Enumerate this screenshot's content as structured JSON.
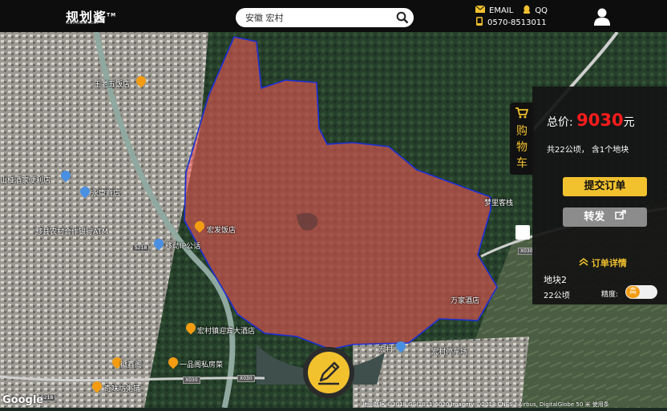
{
  "header": {
    "logo_text": "规划酱",
    "logo_tm": "TM",
    "logo_sub": "GuihuaO.com",
    "search_value": "安徽 宏村",
    "email_label": "EMAIL",
    "qq_label": "QQ",
    "phone": "0570-8513011"
  },
  "map": {
    "pois": [
      {
        "name": "王老五饭店"
      },
      {
        "name": "山桠酒家便利店"
      },
      {
        "name": "永康商店"
      },
      {
        "name": "黟县农村合作银行ATM"
      },
      {
        "name": "移动IP公话"
      },
      {
        "name": "宏发饭店"
      },
      {
        "name": "万家酒店"
      },
      {
        "name": "宏村镇迎宾大酒店"
      },
      {
        "name": "宏村"
      },
      {
        "name": "宏村停车场"
      },
      {
        "name": "徽鑫阁"
      },
      {
        "name": "一品阁私房菜"
      },
      {
        "name": "奇味坊粥铺"
      },
      {
        "name": "梦里客栈"
      }
    ],
    "road_tags": [
      "X030",
      "X030",
      "S218",
      "S218",
      "X030"
    ],
    "attribution": "地图数据 ©2018 GS(2011)6020 Imagery ©2018 CNES / Airbus, DigitalGlobe   50 米        使用条",
    "google_logo": "Google"
  },
  "cart_tab": {
    "label": "购物车"
  },
  "panel": {
    "price_label": "总价:",
    "price_value": "9030",
    "price_unit": "元",
    "area_text": "共22公顷， 含1个地块",
    "submit_label": "提交订单",
    "share_label": "转发",
    "order_detail_label": "订单详情",
    "plot_name": "地块2",
    "plot_area": "22公顷",
    "precision_label": "精度:",
    "precision_value": "高"
  },
  "colors": {
    "accent": "#f2c12e",
    "price": "#ff1c1c",
    "boundary": "#1a2fd6",
    "fill": "#ff6b6b"
  }
}
